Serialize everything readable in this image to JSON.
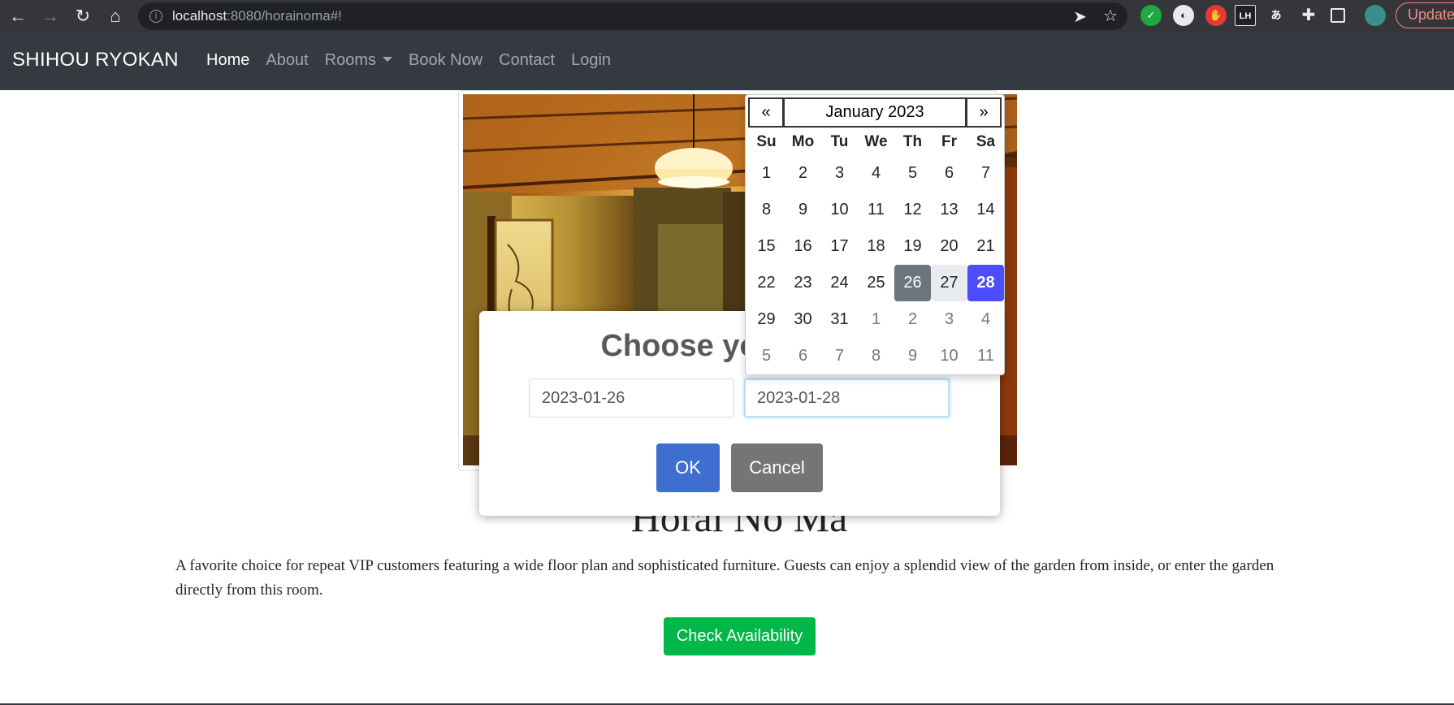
{
  "browser": {
    "url_host": "localhost",
    "url_rest": ":8080/horainoma#!",
    "update_label": "Update",
    "extensions": [
      {
        "name": "green-extension-icon",
        "color": "#1da844",
        "glyph": "✓"
      },
      {
        "name": "grey-extension-icon",
        "color": "#e8eaed",
        "glyph": "◐"
      },
      {
        "name": "hand-extension-icon",
        "color": "#e53935",
        "glyph": "✋"
      },
      {
        "name": "lh-extension-icon",
        "color": "#202124",
        "glyph": "LH"
      },
      {
        "name": "kana-extension-icon",
        "color": "#35363a",
        "glyph": "あ"
      }
    ]
  },
  "nav": {
    "brand": "SHIHOU RYOKAN",
    "links": [
      "Home",
      "About",
      "Rooms",
      "Book Now",
      "Contact",
      "Login"
    ]
  },
  "room": {
    "title": "Horai No Ma",
    "description": "A favorite choice for repeat VIP customers featuring a wide floor plan and sophisticated furniture. Guests can enjoy a splendid view of the garden from inside, or enter the garden directly from this room.",
    "check_label": "Check Availability"
  },
  "modal": {
    "title": "Choose your dates",
    "start_date": "2023-01-26",
    "end_date": "2023-01-28",
    "ok_label": "OK",
    "cancel_label": "Cancel"
  },
  "datepicker": {
    "prev": "«",
    "next": "»",
    "month_label": "January 2023",
    "weekdays": [
      "Su",
      "Mo",
      "Tu",
      "We",
      "Th",
      "Fr",
      "Sa"
    ],
    "days": [
      {
        "d": "1",
        "s": "cur"
      },
      {
        "d": "2",
        "s": "cur"
      },
      {
        "d": "3",
        "s": "cur"
      },
      {
        "d": "4",
        "s": "cur"
      },
      {
        "d": "5",
        "s": "cur"
      },
      {
        "d": "6",
        "s": "cur"
      },
      {
        "d": "7",
        "s": "cur"
      },
      {
        "d": "8",
        "s": "cur"
      },
      {
        "d": "9",
        "s": "cur"
      },
      {
        "d": "10",
        "s": "cur"
      },
      {
        "d": "11",
        "s": "cur"
      },
      {
        "d": "12",
        "s": "cur"
      },
      {
        "d": "13",
        "s": "cur"
      },
      {
        "d": "14",
        "s": "cur"
      },
      {
        "d": "15",
        "s": "cur"
      },
      {
        "d": "16",
        "s": "cur"
      },
      {
        "d": "17",
        "s": "cur"
      },
      {
        "d": "18",
        "s": "cur"
      },
      {
        "d": "19",
        "s": "cur"
      },
      {
        "d": "20",
        "s": "cur"
      },
      {
        "d": "21",
        "s": "cur"
      },
      {
        "d": "22",
        "s": "cur"
      },
      {
        "d": "23",
        "s": "cur"
      },
      {
        "d": "24",
        "s": "cur"
      },
      {
        "d": "25",
        "s": "cur"
      },
      {
        "d": "26",
        "s": "range-start"
      },
      {
        "d": "27",
        "s": "in-range"
      },
      {
        "d": "28",
        "s": "selected"
      },
      {
        "d": "29",
        "s": "cur"
      },
      {
        "d": "30",
        "s": "cur"
      },
      {
        "d": "31",
        "s": "cur"
      },
      {
        "d": "1",
        "s": "other"
      },
      {
        "d": "2",
        "s": "other"
      },
      {
        "d": "3",
        "s": "other"
      },
      {
        "d": "4",
        "s": "other"
      },
      {
        "d": "5",
        "s": "other"
      },
      {
        "d": "6",
        "s": "other"
      },
      {
        "d": "7",
        "s": "other"
      },
      {
        "d": "8",
        "s": "other"
      },
      {
        "d": "9",
        "s": "other"
      },
      {
        "d": "10",
        "s": "other"
      },
      {
        "d": "11",
        "s": "other"
      }
    ]
  },
  "colors": {
    "navbar": "#343a40",
    "ok_button": "#3e6fd0",
    "cancel_button": "#757575",
    "check_button": "#00b74a",
    "selected_day": "#4d4dff",
    "range_start_day": "#6c757d"
  }
}
